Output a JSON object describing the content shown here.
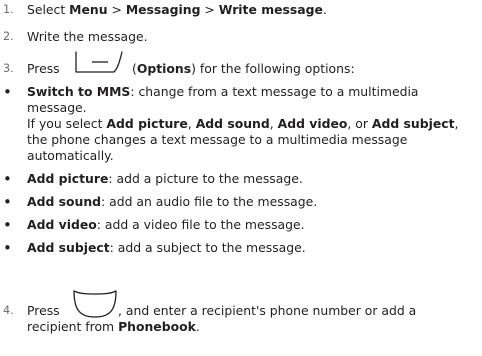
{
  "steps": [
    {
      "number": "1.",
      "pre": "Select ",
      "b1": "Menu",
      "sep1": " > ",
      "b2": "Messaging",
      "sep2": " > ",
      "b3": "Write message",
      "post": "."
    },
    {
      "number": "2.",
      "text": "Write the message."
    },
    {
      "number": "3.",
      "pre": "Press",
      "paren_open": "(",
      "bold": "Options",
      "post": ") for the following options:",
      "key_icon": "left-soft-key-icon"
    },
    {
      "number": "4.",
      "pre": "Press",
      "post_line1": ", and enter a recipient's phone number or add a",
      "line2_pre": "recipient from ",
      "line2_bold": "Phonebook",
      "line2_post": ".",
      "key_icon": "confirm-key-icon"
    }
  ],
  "bullets": [
    {
      "title": "Switch to MMS",
      "line1": ": change from a text message to a multimedia",
      "line2": "message.",
      "note": {
        "l1_pre": "If you select ",
        "l1_b1": "Add picture",
        "l1_c1": ", ",
        "l1_b2": "Add sound",
        "l1_c2": ", ",
        "l1_b3": "Add video",
        "l1_c3": ", or ",
        "l1_b4": "Add subject",
        "l1_post": ",",
        "l2": "the phone changes a text message to a multimedia message",
        "l3": "automatically."
      }
    },
    {
      "title": "Add picture",
      "text": ": add a picture to the message."
    },
    {
      "title": "Add sound",
      "text": ": add an audio file to the message."
    },
    {
      "title": "Add video",
      "text": ": add a video file to the message."
    },
    {
      "title": "Add subject",
      "text": ": add a subject to the message."
    }
  ],
  "bullet_glyph": "•"
}
